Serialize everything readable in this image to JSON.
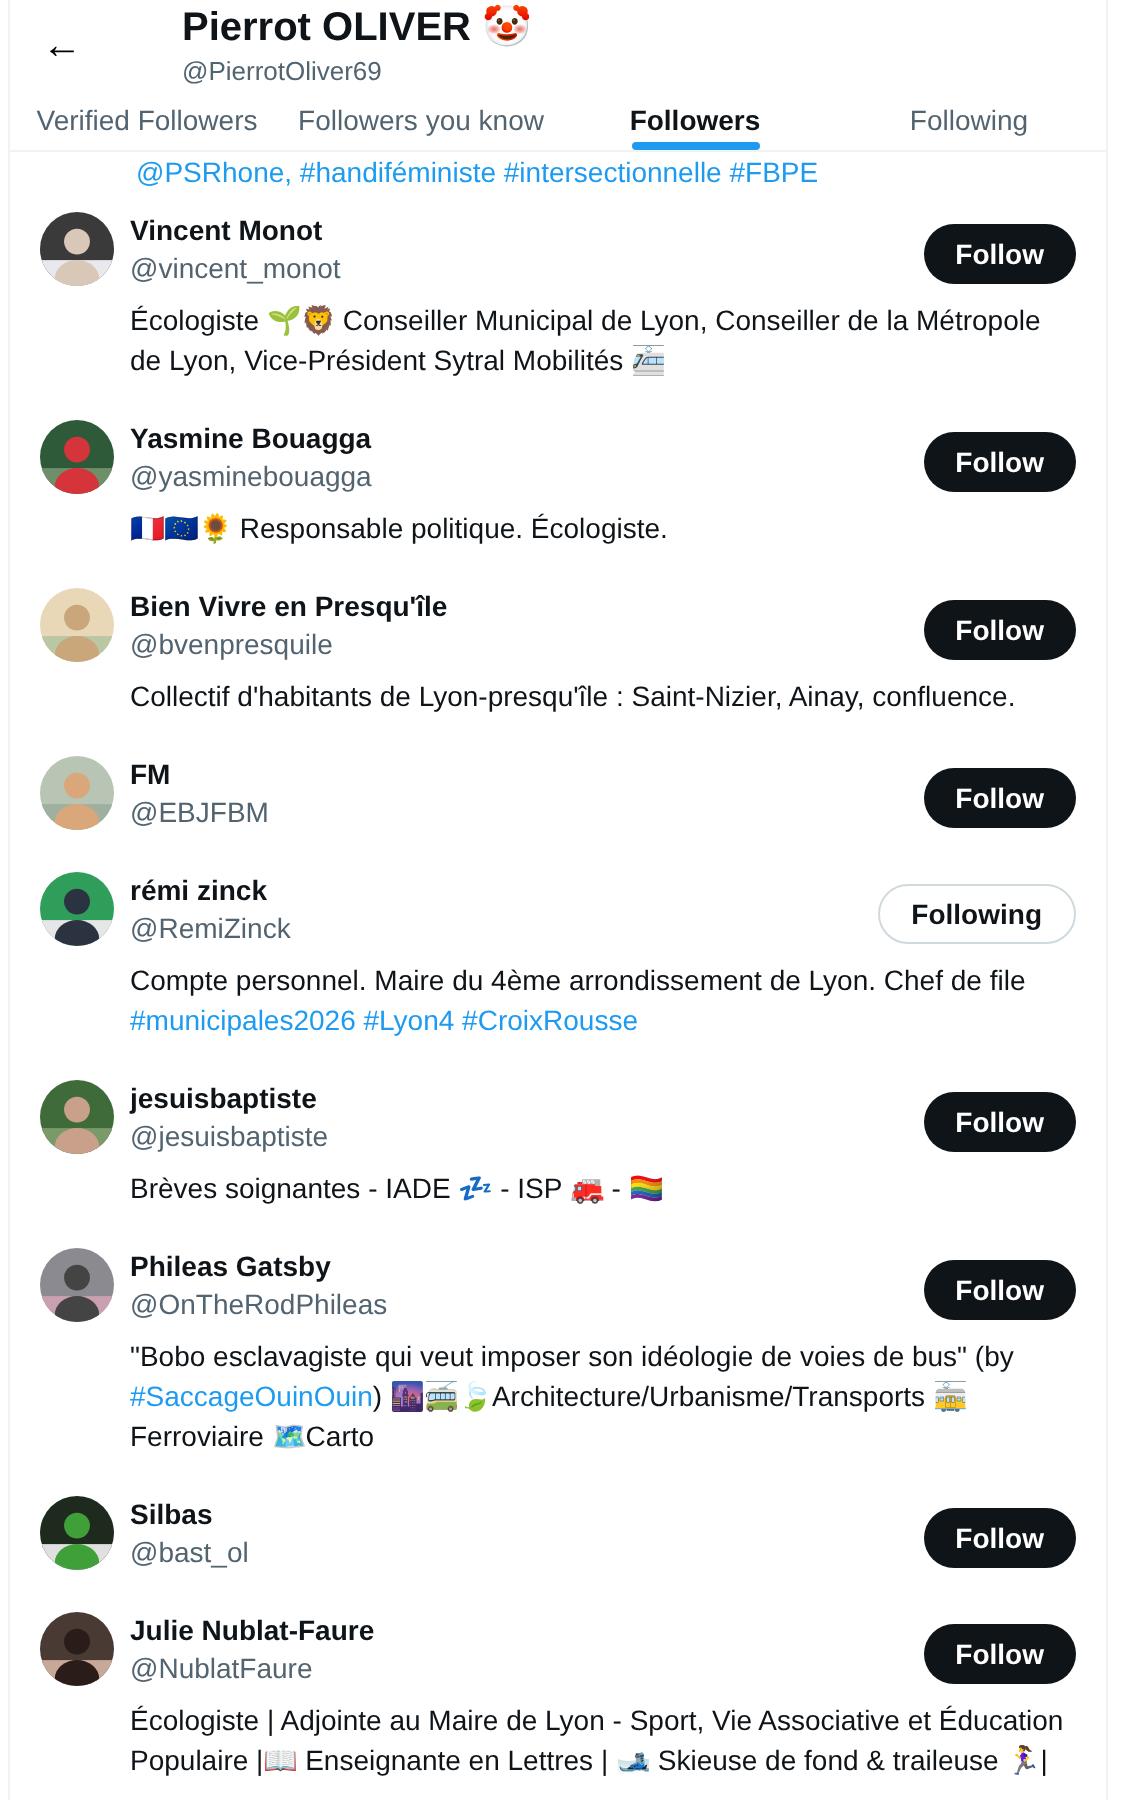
{
  "header": {
    "back": "←",
    "name": "Pierrot OLIVER 🤡",
    "handle": "@PierrotOliver69"
  },
  "tabs": [
    {
      "label": "Verified Followers",
      "selected": false
    },
    {
      "label": "Followers you know",
      "selected": false
    },
    {
      "label": "Followers",
      "selected": true
    },
    {
      "label": "Following",
      "selected": false
    }
  ],
  "partial_bio": [
    {
      "kind": "link",
      "text": "@PSRhone,"
    },
    {
      "kind": "link",
      "text": " #handiféministe"
    },
    {
      "kind": "link",
      "text": " #intersectionnelle"
    },
    {
      "kind": "link",
      "text": " #FBPE"
    }
  ],
  "users": [
    {
      "name": "Vincent Monot",
      "handle": "@vincent_monot",
      "button": "Follow",
      "following": false,
      "avatar": {
        "kind": "picture"
      },
      "bio": [
        {
          "kind": "text",
          "text": "Écologiste 🌱🦁 Conseiller Municipal de Lyon, Conseiller de la Métropole de Lyon, Vice-Président Sytral Mobilités 🚈"
        }
      ]
    },
    {
      "name": "Yasmine Bouagga",
      "handle": "@yasminebouagga",
      "button": "Follow",
      "following": false,
      "avatar": {
        "kind": "picture"
      },
      "bio": [
        {
          "kind": "text",
          "text": "🇫🇷🇪🇺🌻 Responsable politique. Écologiste."
        }
      ]
    },
    {
      "name": "Bien Vivre en Presqu'île",
      "handle": "@bvenpresquile",
      "button": "Follow",
      "following": false,
      "avatar": {
        "kind": "picture"
      },
      "bio": [
        {
          "kind": "text",
          "text": "Collectif d'habitants de Lyon-presqu'île : Saint-Nizier, Ainay, confluence."
        }
      ]
    },
    {
      "name": "FM",
      "handle": "@EBJFBM",
      "button": "Follow",
      "following": false,
      "avatar": {
        "kind": "picture"
      }
    },
    {
      "name": "rémi zinck",
      "handle": "@RemiZinck",
      "button": "Following",
      "following": true,
      "avatar": {
        "kind": "picture"
      },
      "bio": [
        {
          "kind": "text",
          "text": "Compte personnel. Maire du 4ème arrondissement de Lyon. Chef de file "
        },
        {
          "kind": "link",
          "text": "#municipales2026"
        },
        {
          "kind": "link",
          "text": " #Lyon4"
        },
        {
          "kind": "link",
          "text": " #CroixRousse"
        }
      ]
    },
    {
      "name": "jesuisbaptiste",
      "handle": "@jesuisbaptiste",
      "button": "Follow",
      "following": false,
      "avatar": {
        "kind": "picture"
      },
      "bio": [
        {
          "kind": "text",
          "text": "Brèves soignantes - IADE 💤 - ISP 🚒 - 🏳️‍🌈"
        }
      ]
    },
    {
      "name": "Phileas Gatsby",
      "handle": "@OnTheRodPhileas",
      "button": "Follow",
      "following": false,
      "avatar": {
        "kind": "picture"
      },
      "bio": [
        {
          "kind": "text",
          "text": "\"Bobo esclavagiste qui veut imposer son idéologie de voies de bus\" (by "
        },
        {
          "kind": "link",
          "text": "#SaccageOuinOuin"
        },
        {
          "kind": "text",
          "text": ") 🌆🚎🍃Architecture/Urbanisme/Transports 🚋 Ferroviaire 🗺️Carto"
        }
      ]
    },
    {
      "name": "Silbas",
      "handle": "@bast_ol",
      "button": "Follow",
      "following": false,
      "avatar": {
        "kind": "picture"
      }
    },
    {
      "name": "Julie Nublat-Faure",
      "handle": "@NublatFaure",
      "button": "Follow",
      "following": false,
      "avatar": {
        "kind": "picture"
      },
      "bio": [
        {
          "kind": "text",
          "text": "Écologiste | Adjointe au Maire de Lyon - Sport, Vie Associative et Éducation Populaire |📖 Enseignante en Lettres | 🎿 Skieuse de fond & traileuse 🏃‍♀️|"
        }
      ]
    }
  ]
}
